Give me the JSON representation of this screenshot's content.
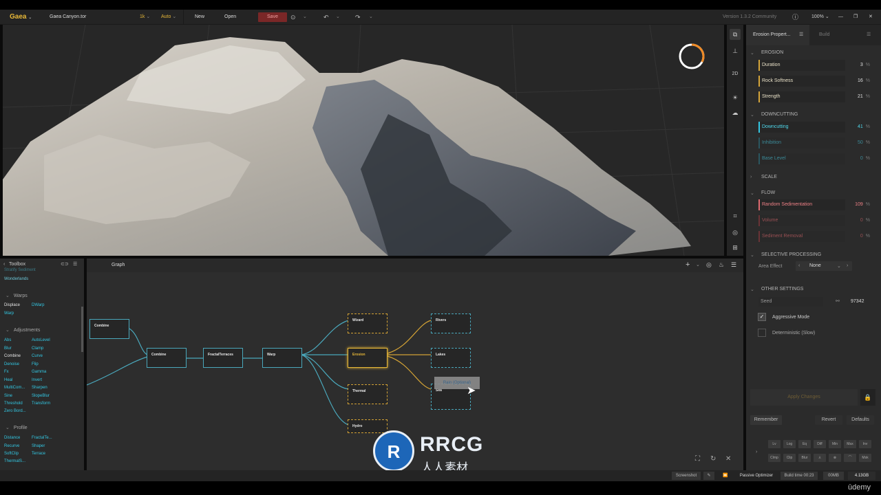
{
  "topbar": {
    "app_name": "Gaea",
    "file_name": "Gaea Canyon.tor",
    "resolution": "1k",
    "mode": "Auto",
    "new_label": "New",
    "open_label": "Open",
    "save_label": "Save",
    "version": "Version 1.3.2 Community",
    "zoom": "100%"
  },
  "viewport_tools": [
    "2D"
  ],
  "props": {
    "tab_properties": "Erosion Propert...",
    "tab_build": "Build",
    "sections": {
      "erosion": "EROSION",
      "downcutting": "DOWNCUTTING",
      "scale": "SCALE",
      "flow": "FLOW",
      "selective": "SELECTIVE PROCESSING",
      "other": "OTHER SETTINGS"
    },
    "erosion_params": [
      {
        "label": "Duration",
        "value": "3"
      },
      {
        "label": "Rock Softness",
        "value": "16"
      },
      {
        "label": "Strength",
        "value": "21"
      }
    ],
    "downcutting_params": [
      {
        "label": "Downcutting",
        "value": "41"
      },
      {
        "label": "Inhibition",
        "value": "50"
      },
      {
        "label": "Base Level",
        "value": "0"
      }
    ],
    "flow_params": [
      {
        "label": "Random Sedimentation",
        "value": "109"
      },
      {
        "label": "Volume",
        "value": "0"
      },
      {
        "label": "Sediment Removal",
        "value": "0"
      }
    ],
    "pct": "%",
    "area_effect_label": "Area Effect",
    "area_effect_value": "None",
    "seed_label": "Seed",
    "seed_value": "97342",
    "aggressive_mode": "Aggressive Mode",
    "deterministic": "Deterministic (Slow)",
    "apply_changes": "Apply Changes",
    "remember": "Remember",
    "revert": "Revert",
    "defaults": "Defaults",
    "mini_row1": [
      "Lv",
      "Log",
      "Eq",
      "Diff",
      "Min",
      "Max",
      "Inv"
    ],
    "mini_row2": [
      "Clmp",
      "Clip",
      "Blur",
      "⅄",
      "⊗",
      "⌒",
      "Msk"
    ]
  },
  "toolbox": {
    "title": "Toolbox",
    "clipped_top": "Stratify  Sediment",
    "wonderlands": "Wonderlands",
    "warps_header": "Warps",
    "warps": [
      [
        "Displace",
        "DWarp"
      ],
      [
        "Warp",
        ""
      ]
    ],
    "adjust_header": "Adjustments",
    "adjustments": [
      [
        "Abs",
        "AutoLevel"
      ],
      [
        "Blur",
        "Clamp"
      ],
      [
        "Combine",
        "Curve"
      ],
      [
        "Denoise",
        "Flip"
      ],
      [
        "Fx",
        "Gamma"
      ],
      [
        "Heal",
        "Invert"
      ],
      [
        "MultiCom...",
        "Sharpen"
      ],
      [
        "Sine",
        "SlopeBlur"
      ],
      [
        "Threshold",
        "Transform"
      ],
      [
        "Zero Bord...",
        ""
      ]
    ],
    "profile_header": "Profile",
    "profile": [
      [
        "Distance",
        "FractalTe..."
      ],
      [
        "Recurve",
        "Shaper"
      ],
      [
        "SoftClip",
        "Terrace"
      ],
      [
        "ThermalS...",
        ""
      ]
    ]
  },
  "graph": {
    "title": "Graph",
    "nodes": {
      "combine1": "Combine",
      "combine2": "Combine",
      "fractal": "FractalTerraces",
      "warp": "Warp",
      "wizard": "Wizard",
      "erosion": "Erosion",
      "thermal": "Thermal",
      "hydro": "Hydro",
      "rivers": "Rivers",
      "lakes": "Lakes",
      "sea": "Sea"
    },
    "tooltip": "Rain (Optional)"
  },
  "status": {
    "screenshot": "Screenshot",
    "passive_optimizer": "Passive Optimizer",
    "build_time": "Build time 00:23",
    "mem1": "00MB",
    "mem2": "4.13GB"
  },
  "watermark": {
    "brand": "RRCG",
    "cn": "人人素材",
    "udemy": "ūdemy"
  },
  "colors": {
    "accent_orange": "#d6a63a",
    "accent_teal": "#33c8e4",
    "flow_red": "#e06b70"
  }
}
